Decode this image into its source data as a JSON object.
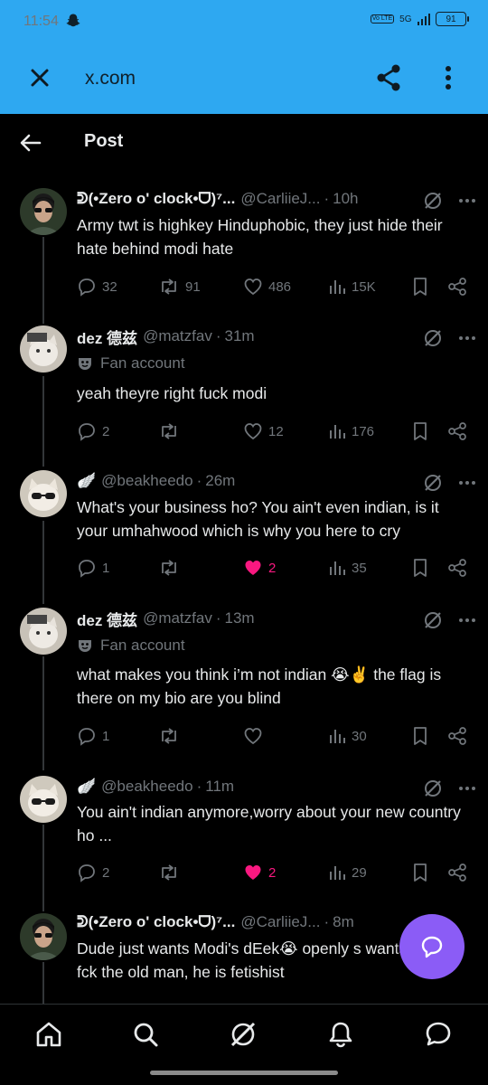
{
  "status_bar": {
    "time": "11:54",
    "network": "5G",
    "volte": "Vo LTE",
    "battery": "91"
  },
  "browser": {
    "url": "x.com"
  },
  "page": {
    "title": "Post"
  },
  "colors": {
    "chrome": "#2ea8f1",
    "like": "#f91880",
    "fab": "#8b5cf6",
    "muted": "#71767b"
  },
  "posts": [
    {
      "name": "ᕲ(•Zero o' clock•ᗜ)⁷...",
      "handle": "@CarliieJ...",
      "time": "10h",
      "badge": "",
      "text": "Army twt is highkey Hinduphobic, they just hide their hate behind modi hate",
      "replies": "32",
      "reposts": "91",
      "likes": "486",
      "views": "15K",
      "liked": false
    },
    {
      "name": "dez 德兹",
      "handle": "@matzfav",
      "time": "31m",
      "badge": "Fan account",
      "text": "yeah theyre right fuck modi",
      "replies": "2",
      "reposts": "",
      "likes": "12",
      "views": "176",
      "liked": false
    },
    {
      "name": "🪽",
      "handle": "@beakheedo",
      "time": "26m",
      "badge": "",
      "text": "What's your business ho? You ain't even indian, is it your umhahwood which is why you here to cry",
      "replies": "1",
      "reposts": "",
      "likes": "2",
      "views": "35",
      "liked": true
    },
    {
      "name": "dez 德兹",
      "handle": "@matzfav",
      "time": "13m",
      "badge": "Fan account",
      "text": "what makes you think i’m not indian 😭✌️ the flag is there on my bio are you blind",
      "replies": "1",
      "reposts": "",
      "likes": "",
      "views": "30",
      "liked": false
    },
    {
      "name": "🪽",
      "handle": "@beakheedo",
      "time": "11m",
      "badge": "",
      "text": "You ain't indian anymore,worry about your new country ho ...",
      "replies": "2",
      "reposts": "",
      "likes": "2",
      "views": "29",
      "liked": true
    },
    {
      "name": "ᕲ(•Zero o' clock•ᗜ)⁷...",
      "handle": "@CarliieJ...",
      "time": "8m",
      "badge": "",
      "text": "Dude just wants Modi's dEek😭 openly s wants to fck the old man, he is fetishist",
      "replies": "",
      "reposts": "",
      "likes": "",
      "views": "",
      "liked": false
    }
  ],
  "icons": {
    "close": "close-icon",
    "share": "share-icon",
    "more": "more-vertical-icon",
    "back": "back-arrow-icon",
    "grok": "grok-icon",
    "reply": "reply-icon",
    "repost": "repost-icon",
    "like": "heart-icon",
    "views": "views-icon",
    "bookmark": "bookmark-icon",
    "fab": "compose-chat-icon",
    "nav": [
      "home-icon",
      "search-icon",
      "grok-icon",
      "notifications-icon",
      "messages-icon"
    ]
  }
}
